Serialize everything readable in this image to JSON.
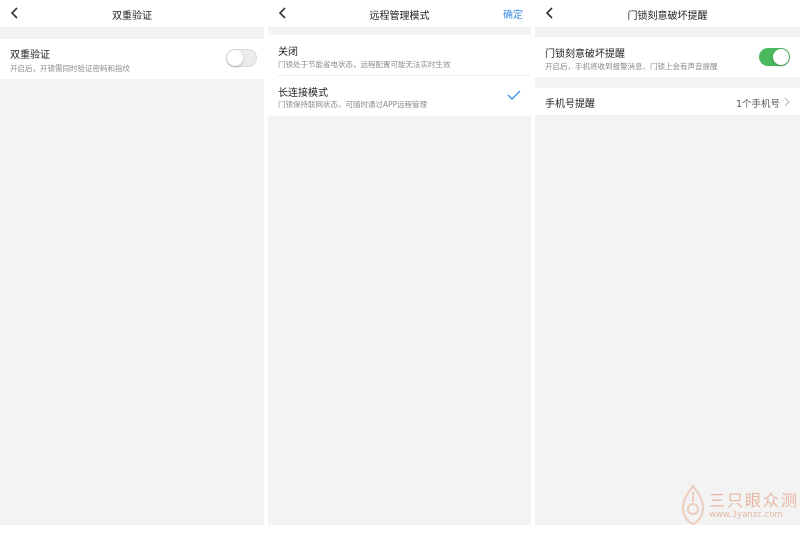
{
  "screen1": {
    "title": "双重验证",
    "row": {
      "title": "双重验证",
      "desc": "开启后，开锁需同时验证密码和指纹",
      "toggle_state": "off"
    }
  },
  "screen2": {
    "title": "远程管理模式",
    "confirm_label": "确定",
    "options": [
      {
        "title": "关闭",
        "desc": "门锁处于节能省电状态，远程配置可能无法实时生效",
        "selected": false
      },
      {
        "title": "长连接模式",
        "desc": "门锁保持联网状态，可随时通过APP远程管理",
        "selected": true
      }
    ]
  },
  "screen3": {
    "title": "门锁刻意破坏提醒",
    "alarm_row": {
      "title": "门锁刻意破坏提醒",
      "desc": "开启后，手机将收到报警消息、门锁上会有声音提醒",
      "toggle_state": "on"
    },
    "phone_row": {
      "title": "手机号提醒",
      "value": "1个手机号"
    }
  },
  "watermark": {
    "name": "三只眼众测",
    "url": "www.3yanzc.com"
  },
  "colors": {
    "accent_blue": "#3c8ee6",
    "toggle_on": "#4cb85e",
    "background": "#f3f3f3"
  },
  "icons": [
    "chevron-left-icon",
    "check-icon",
    "chevron-right-icon",
    "logo-icon"
  ]
}
